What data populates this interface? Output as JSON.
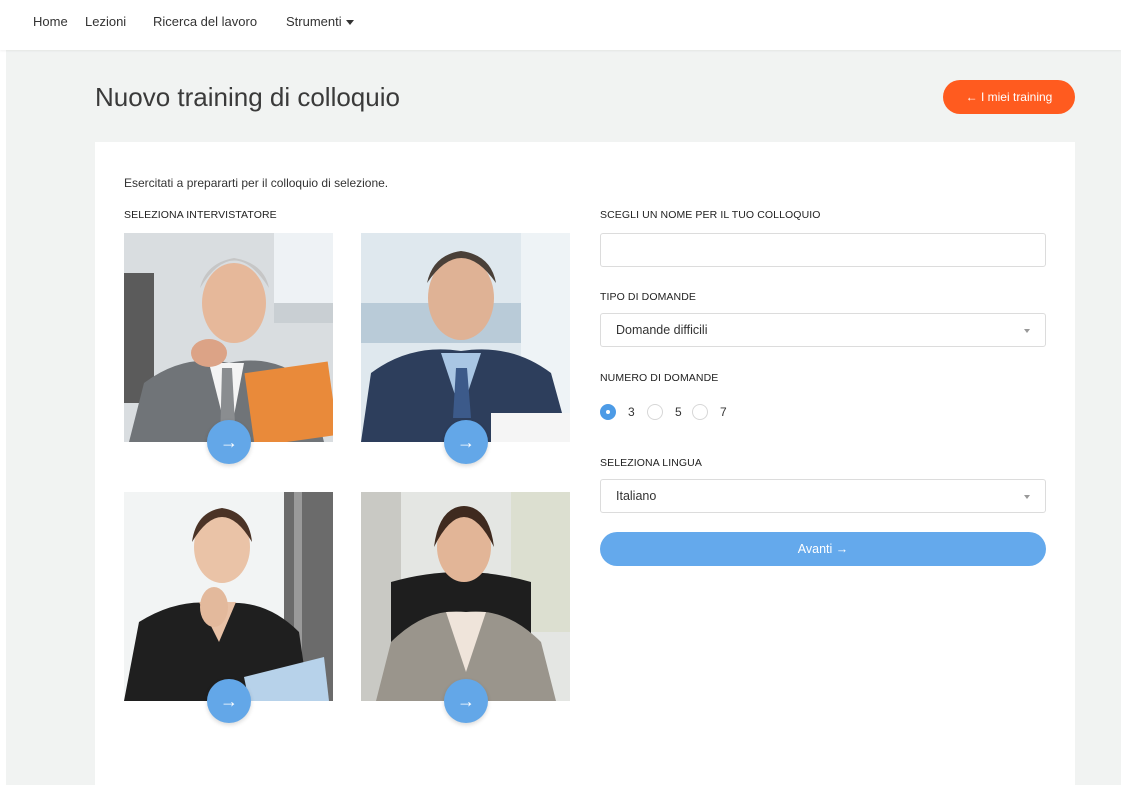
{
  "nav": {
    "items": [
      {
        "label": "Home"
      },
      {
        "label": "Lezioni"
      },
      {
        "label": "Ricerca del lavoro"
      },
      {
        "label": "Strumenti"
      }
    ]
  },
  "page": {
    "title": "Nuovo training di colloquio",
    "back_label": "← I miei training",
    "intro": "Esercitati a prepararti per il colloquio di selezione."
  },
  "interviewers": {
    "label": "SELEZIONA INTERVISTATORE",
    "select_arrow": "→"
  },
  "form": {
    "name_label": "SCEGLI UN NOME PER IL TUO COLLOQUIO",
    "name_value": "",
    "type_label": "TIPO DI DOMANDE",
    "type_value": "Domande difficili",
    "count_label": "NUMERO DI DOMANDE",
    "count_options": [
      "3",
      "5",
      "7"
    ],
    "count_selected": "3",
    "lang_label": "SELEZIONA LINGUA",
    "lang_value": "Italiano",
    "submit_label": "Avanti →"
  },
  "colors": {
    "accent_orange": "#ff5b1f",
    "accent_blue": "#64a9ec",
    "page_bg": "#f1f3f2"
  }
}
